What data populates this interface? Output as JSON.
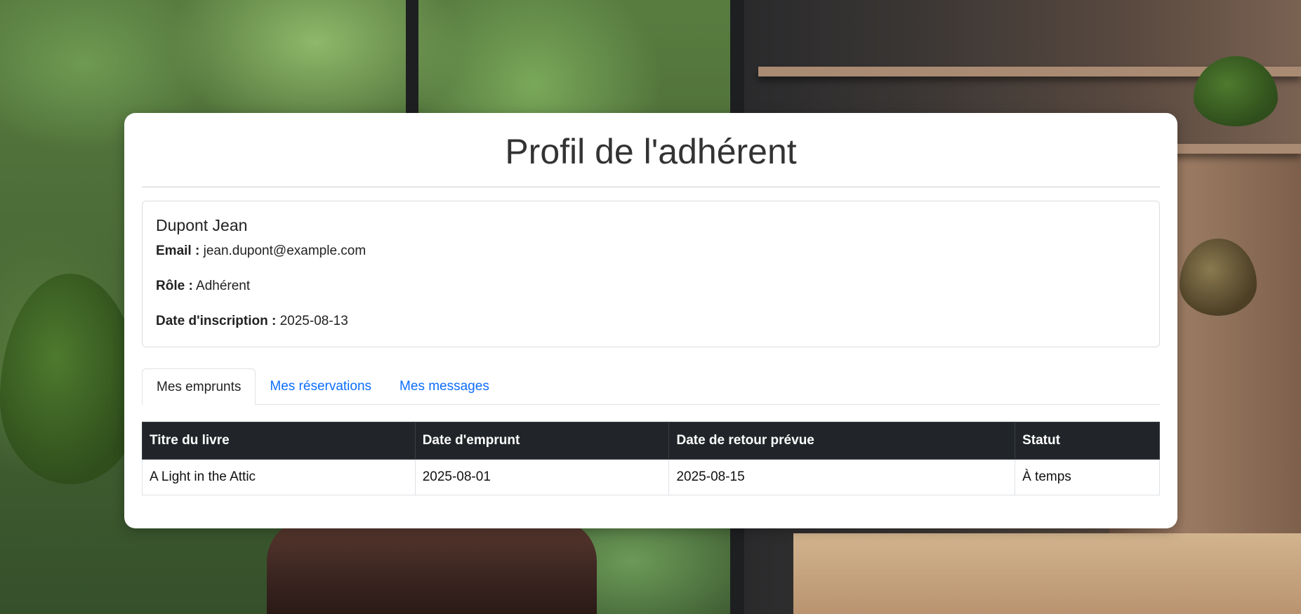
{
  "page": {
    "title": "Profil de l'adhérent"
  },
  "member": {
    "name": "Dupont Jean",
    "email_label": "Email :",
    "email": "jean.dupont@example.com",
    "role_label": "Rôle :",
    "role": "Adhérent",
    "signup_label": "Date d'inscription :",
    "signup_date": "2025-08-13"
  },
  "tabs": [
    {
      "label": "Mes emprunts",
      "active": true
    },
    {
      "label": "Mes réservations",
      "active": false
    },
    {
      "label": "Mes messages",
      "active": false
    }
  ],
  "loans_table": {
    "headers": [
      "Titre du livre",
      "Date d'emprunt",
      "Date de retour prévue",
      "Statut"
    ],
    "rows": [
      [
        "A Light in the Attic",
        "2025-08-01",
        "2025-08-15",
        "À temps"
      ]
    ]
  },
  "colors": {
    "tab_link": "#0d6efd",
    "table_header_bg": "#212529"
  }
}
